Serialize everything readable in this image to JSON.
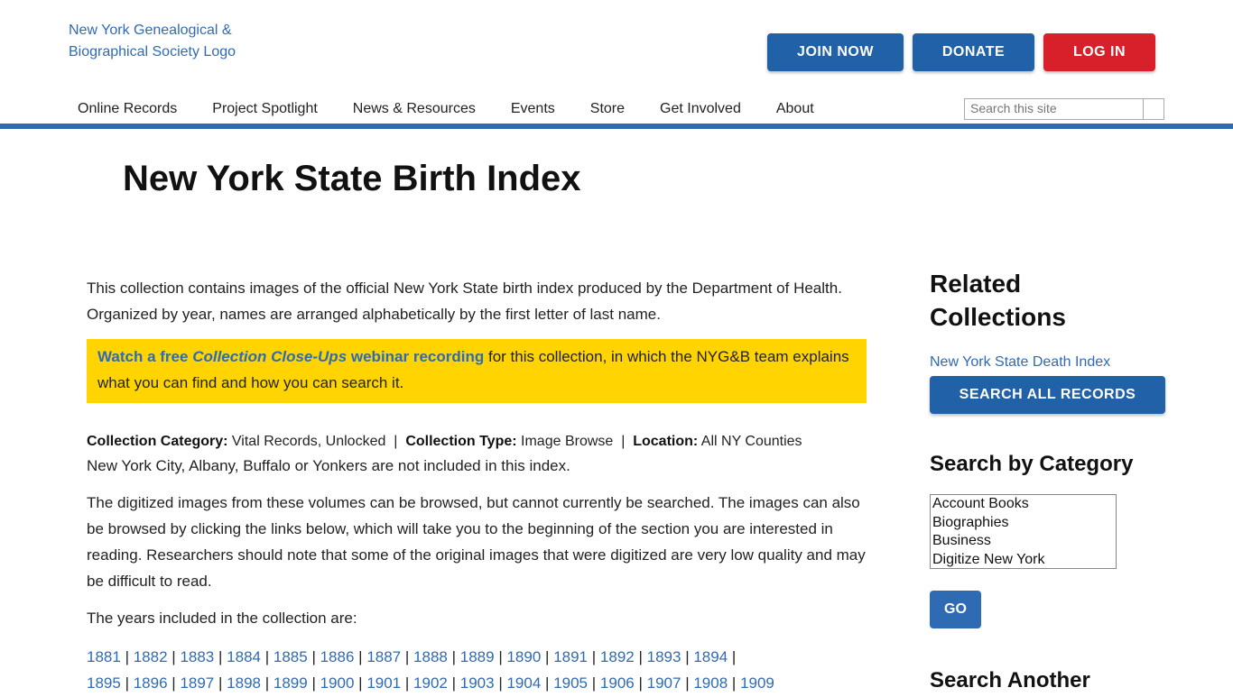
{
  "header": {
    "logo_alt": "New York Genealogical & Biographical Society Logo",
    "join_label": "JOIN NOW",
    "donate_label": "DONATE",
    "login_label": "LOG IN",
    "search_placeholder": "Search this site"
  },
  "nav": {
    "items": [
      "Online Records",
      "Project Spotlight",
      "News & Resources",
      "Events",
      "Store",
      "Get Involved",
      "About"
    ]
  },
  "colors": {
    "brand_blue": "#2061a8",
    "link_blue": "#2f6bb3",
    "login_red": "#d8202a",
    "callout_yellow": "#ffd400"
  },
  "page": {
    "title": "New York State Birth Index",
    "intro": "This collection contains images of the official New York State birth index produced by the Department of Health. Organized by year, names are arranged alphabetically by the first letter of last name.",
    "callout_link": {
      "pre": "Watch a free ",
      "italic": "Collection Close-Ups",
      "post": " webinar recording"
    },
    "callout_rest": " for this collection, in which the NYG&B team explains what you can find and how you can search it.",
    "meta": {
      "category_label": "Collection Category:",
      "category_value": "Vital Records, Unlocked",
      "type_label": "Collection Type:",
      "type_value": "Image Browse",
      "location_label": "Location:",
      "location_value": "All NY Counties",
      "divider": "|",
      "note": "New York City, Albany, Buffalo or Yonkers are not included in this index."
    },
    "browse_text": "The digitized images from these volumes can be browsed, but cannot currently be searched. The images can also be browsed by clicking the links below, which will take you to the beginning of the section you are interested in reading. Researchers should note that some of the original images that were digitized are very low quality and may be difficult to read.",
    "years_intro": "The years included in the collection are:",
    "years": [
      "1881",
      "1882",
      "1883",
      "1884",
      "1885",
      "1886",
      "1887",
      "1888",
      "1889",
      "1890",
      "1891",
      "1892",
      "1893",
      "1894",
      "1895",
      "1896",
      "1897",
      "1898",
      "1899",
      "1900",
      "1901",
      "1902",
      "1903",
      "1904",
      "1905",
      "1906",
      "1907",
      "1908",
      "1909"
    ]
  },
  "sidebar": {
    "related_title": "Related Collections",
    "related_link": "New York State Death Index",
    "search_all_label": "SEARCH ALL RECORDS",
    "category_title": "Search by Category",
    "categories": [
      "Account Books",
      "Biographies",
      "Business",
      "Digitize New York"
    ],
    "go_label": "GO",
    "another_title": "Search Another"
  }
}
